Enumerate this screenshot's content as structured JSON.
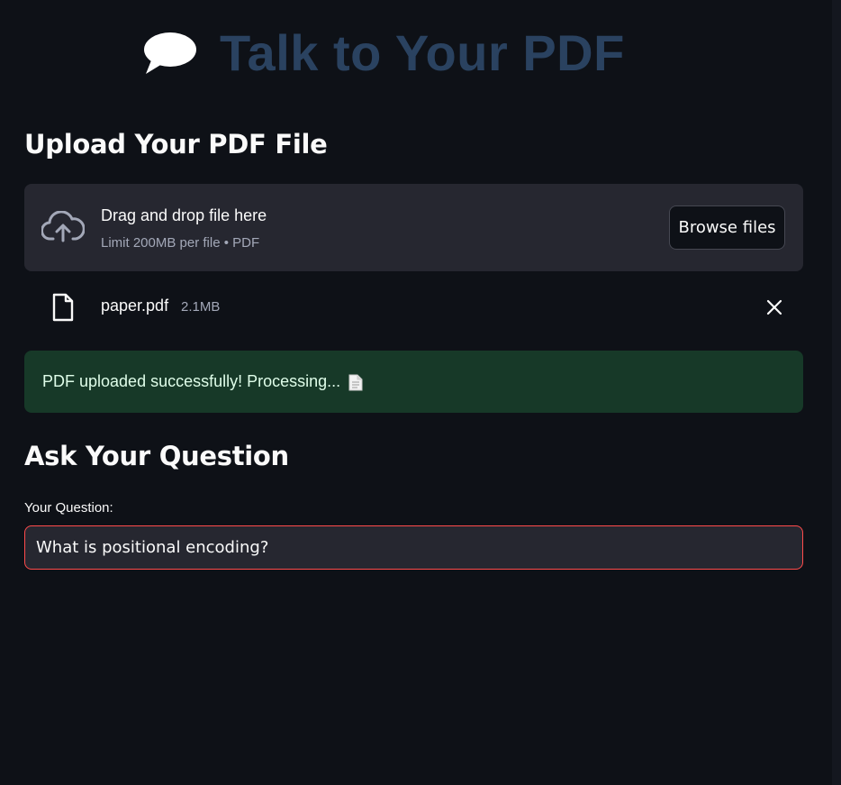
{
  "header": {
    "title": "Talk to Your PDF",
    "icon": "speech-bubble-icon"
  },
  "upload": {
    "section_title": "Upload Your PDF File",
    "drag_text": "Drag and drop file here",
    "limit_text": "Limit 200MB per file • PDF",
    "browse_label": "Browse files",
    "icon": "cloud-upload-icon"
  },
  "uploaded_file": {
    "name": "paper.pdf",
    "size": "2.1MB",
    "icon": "file-icon",
    "remove_icon": "close-icon"
  },
  "status": {
    "message": "PDF uploaded successfully! Processing...",
    "icon": "page-facing-up-icon",
    "color": "#173928"
  },
  "question": {
    "section_title": "Ask Your Question",
    "label": "Your Question:",
    "value": "What is positional encoding?",
    "border_color": "#ff4b4b"
  },
  "theme": {
    "background": "#0e1117",
    "surface": "#262730",
    "title_color": "#2a4260"
  }
}
